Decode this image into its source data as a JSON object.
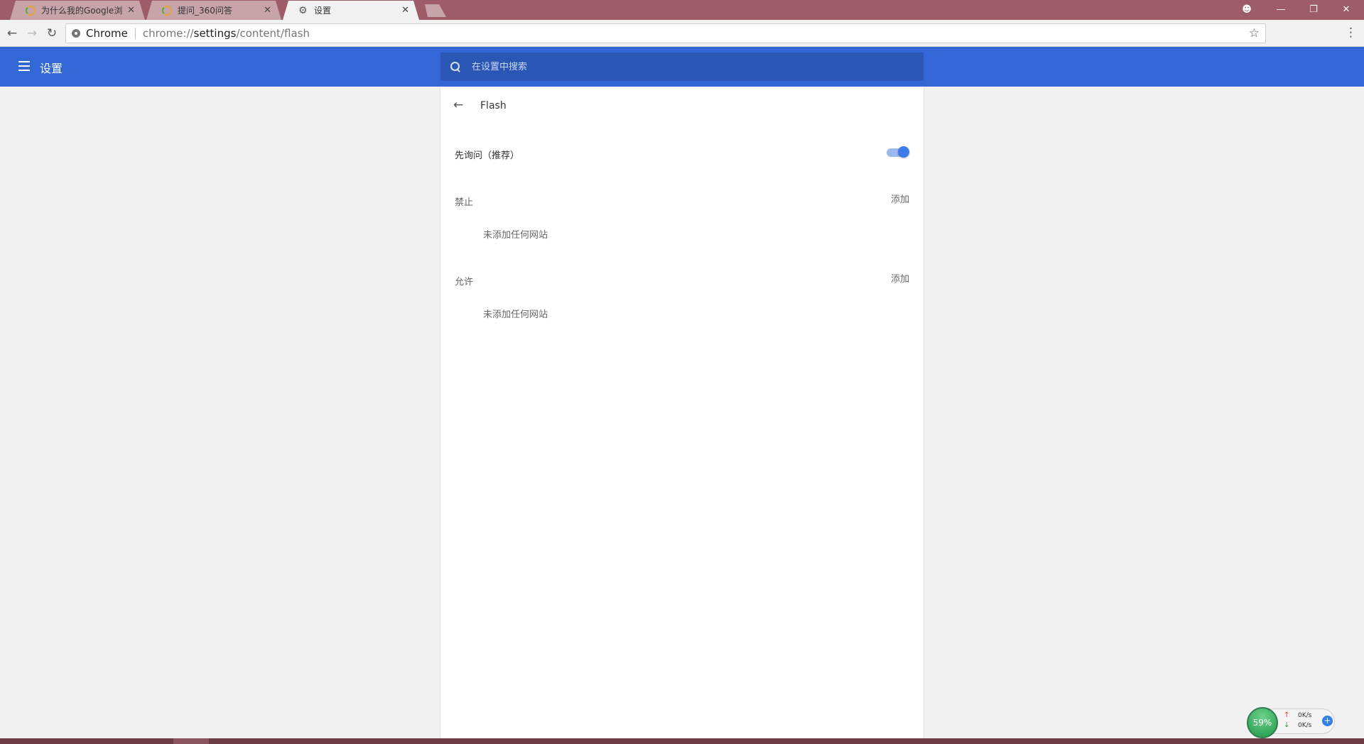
{
  "tabs": [
    {
      "title": "为什么我的Google浏览器",
      "close": "✕"
    },
    {
      "title": "提问_360问答",
      "close": "✕"
    },
    {
      "title": "设置",
      "close": "✕"
    }
  ],
  "window_controls": {
    "profile": "☻",
    "minimize": "—",
    "restore": "❐",
    "close": "✕"
  },
  "toolbar": {
    "back": "←",
    "forward": "→",
    "reload": "↻",
    "origin": "Chrome",
    "url_prefix": "chrome://",
    "url_host": "settings",
    "url_path": "/content/flash",
    "star": "☆",
    "menu": "⋮"
  },
  "settings": {
    "title": "设置",
    "search_placeholder": "在设置中搜索"
  },
  "flash_page": {
    "back": "←",
    "title": "Flash",
    "ask_first_label": "先询问（推荐）",
    "ask_first_enabled": true,
    "block": {
      "label": "禁止",
      "add": "添加",
      "empty": "未添加任何网站"
    },
    "allow": {
      "label": "允许",
      "add": "添加",
      "empty": "未添加任何网站"
    }
  },
  "net_widget": {
    "percent": "59%",
    "up_arrow": "↑",
    "down_arrow": "↓",
    "up": "0K/s",
    "down": "0K/s",
    "plus": "+"
  },
  "colors": {
    "tabbar": "#9e5b68",
    "header": "#3367d6",
    "search": "#2a56b5",
    "toggle": "#3e7be8"
  }
}
